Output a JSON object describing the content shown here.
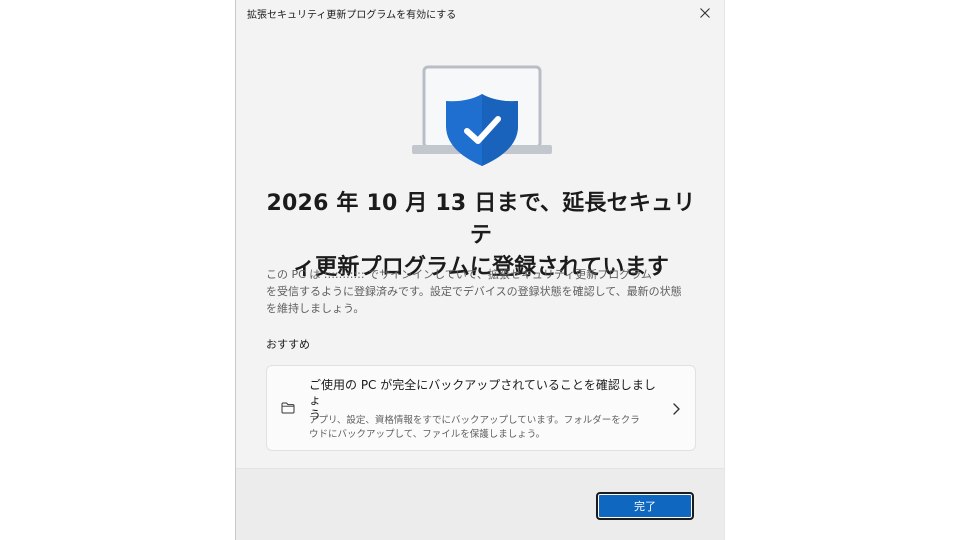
{
  "dialog": {
    "title": "拡張セキュリティ更新プログラムを有効にする",
    "close_icon": "close-icon"
  },
  "hero": {
    "icon": "laptop-shield-check-icon",
    "colors": {
      "shield": "#1f6fd1",
      "laptop": "#c9cdd3"
    }
  },
  "main": {
    "heading_line1": "2026 年 10 月 13 日まで、延長セキュリテ",
    "heading_line2": "ィ更新プログラムに登録されています",
    "description_line1": "この PC は ::::::::::: でサインインしていて、拡張セキュリティ更新プログラム",
    "description_line2": "を受信するように登録済みです。設定でデバイスの登録状態を確認して、最新の状態",
    "description_line3": "を維持しましょう。"
  },
  "recommendations": {
    "label": "おすすめ",
    "card": {
      "icon": "folder-icon",
      "title_line1": "ご使用の PC が完全にバックアップされていることを確認しましょ",
      "title_line2": "う",
      "sub_line1": "アプリ、設定、資格情報をすでにバックアップしています。フォルダーをクラ",
      "sub_line2": "ウドにバックアップして、ファイルを保護しましょう。",
      "chevron_icon": "chevron-right-icon"
    }
  },
  "footer": {
    "done_label": "完了",
    "accent": "#0f67c0"
  }
}
